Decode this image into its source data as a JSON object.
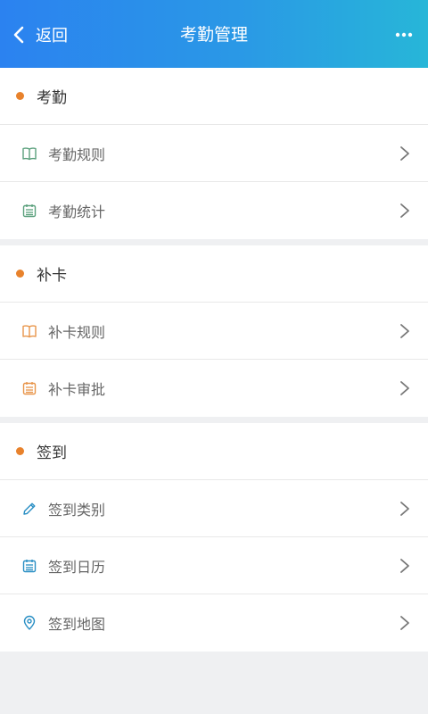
{
  "header": {
    "back_label": "返回",
    "title": "考勤管理"
  },
  "colors": {
    "header_start": "#2b82f0",
    "header_end": "#27b6d8",
    "bullet": "#e8822c",
    "icon_green": "#5aa07c",
    "icon_orange": "#e8954a",
    "icon_blue": "#2a8fc4"
  },
  "sections": [
    {
      "title": "考勤",
      "items": [
        {
          "label": "考勤规则",
          "icon": "book-icon"
        },
        {
          "label": "考勤统计",
          "icon": "calendar-icon"
        }
      ]
    },
    {
      "title": "补卡",
      "items": [
        {
          "label": "补卡规则",
          "icon": "book-icon"
        },
        {
          "label": "补卡审批",
          "icon": "calendar-icon"
        }
      ]
    },
    {
      "title": "签到",
      "items": [
        {
          "label": "签到类别",
          "icon": "pencil-icon"
        },
        {
          "label": "签到日历",
          "icon": "calendar-icon"
        },
        {
          "label": "签到地图",
          "icon": "location-pin-icon"
        }
      ]
    }
  ]
}
